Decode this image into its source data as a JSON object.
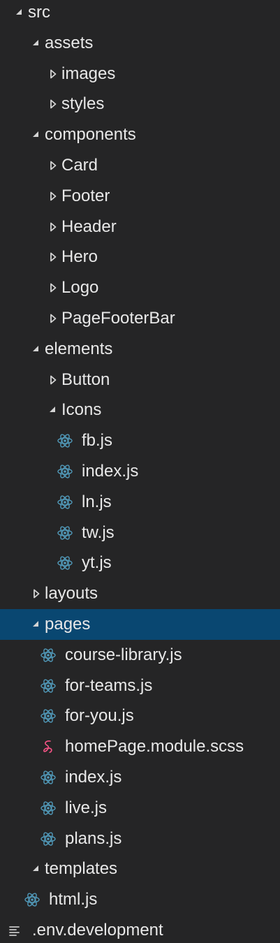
{
  "explorer": {
    "selected_color": "#094771",
    "react_icon_color": "#519aba",
    "sass_icon_color": "#f55385",
    "rows": [
      {
        "label": "src",
        "kind": "folder",
        "expanded": true,
        "depth": 0
      },
      {
        "label": "assets",
        "kind": "folder",
        "expanded": true,
        "depth": 1
      },
      {
        "label": "images",
        "kind": "folder",
        "expanded": false,
        "depth": 2
      },
      {
        "label": "styles",
        "kind": "folder",
        "expanded": false,
        "depth": 2
      },
      {
        "label": "components",
        "kind": "folder",
        "expanded": true,
        "depth": 1
      },
      {
        "label": "Card",
        "kind": "folder",
        "expanded": false,
        "depth": 2
      },
      {
        "label": "Footer",
        "kind": "folder",
        "expanded": false,
        "depth": 2
      },
      {
        "label": "Header",
        "kind": "folder",
        "expanded": false,
        "depth": 2
      },
      {
        "label": "Hero",
        "kind": "folder",
        "expanded": false,
        "depth": 2
      },
      {
        "label": "Logo",
        "kind": "folder",
        "expanded": false,
        "depth": 2
      },
      {
        "label": "PageFooterBar",
        "kind": "folder",
        "expanded": false,
        "depth": 2
      },
      {
        "label": "elements",
        "kind": "folder",
        "expanded": true,
        "depth": 1
      },
      {
        "label": "Button",
        "kind": "folder",
        "expanded": false,
        "depth": 2
      },
      {
        "label": "Icons",
        "kind": "folder",
        "expanded": true,
        "depth": 2
      },
      {
        "label": "fb.js",
        "kind": "react-file",
        "depth": 3
      },
      {
        "label": "index.js",
        "kind": "react-file",
        "depth": 3
      },
      {
        "label": "ln.js",
        "kind": "react-file",
        "depth": 3
      },
      {
        "label": "tw.js",
        "kind": "react-file",
        "depth": 3
      },
      {
        "label": "yt.js",
        "kind": "react-file",
        "depth": 3
      },
      {
        "label": "layouts",
        "kind": "folder",
        "expanded": false,
        "depth": 1
      },
      {
        "label": "pages",
        "kind": "folder",
        "expanded": true,
        "depth": 1,
        "selected": true
      },
      {
        "label": "course-library.js",
        "kind": "react-file",
        "depth": 2
      },
      {
        "label": "for-teams.js",
        "kind": "react-file",
        "depth": 2
      },
      {
        "label": "for-you.js",
        "kind": "react-file",
        "depth": 2
      },
      {
        "label": "homePage.module.scss",
        "kind": "sass-file",
        "depth": 2
      },
      {
        "label": "index.js",
        "kind": "react-file",
        "depth": 2
      },
      {
        "label": "live.js",
        "kind": "react-file",
        "depth": 2
      },
      {
        "label": "plans.js",
        "kind": "react-file",
        "depth": 2
      },
      {
        "label": "templates",
        "kind": "folder",
        "expanded": true,
        "depth": 1
      },
      {
        "label": "html.js",
        "kind": "react-file",
        "depth": 1
      },
      {
        "label": ".env.development",
        "kind": "text-file",
        "depth": 0
      }
    ]
  }
}
